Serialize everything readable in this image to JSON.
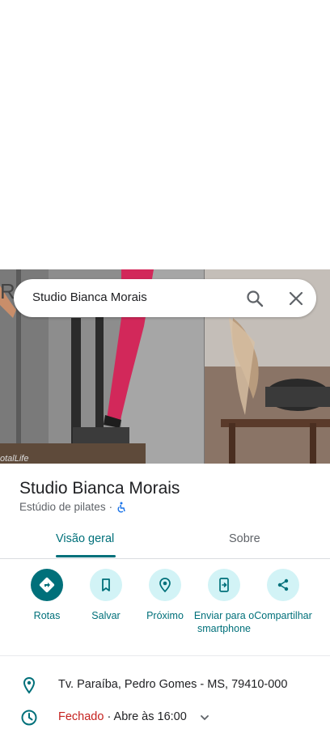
{
  "search": {
    "query": "Studio Bianca Morais"
  },
  "place": {
    "title": "Studio Bianca Morais",
    "category": "Estúdio de pilates",
    "separator": "·"
  },
  "photos": {
    "watermark_left": "R",
    "watermark_bottom": "otalLife"
  },
  "tabs": [
    {
      "label": "Visão geral",
      "active": true
    },
    {
      "label": "Sobre",
      "active": false
    }
  ],
  "actions": [
    {
      "label": "Rotas",
      "icon": "directions-icon"
    },
    {
      "label": "Salvar",
      "icon": "bookmark-icon"
    },
    {
      "label": "Próximo",
      "icon": "nearby-icon"
    },
    {
      "label": "Enviar para o smartphone",
      "icon": "send-to-phone-icon"
    },
    {
      "label": "Compartilhar",
      "icon": "share-icon"
    }
  ],
  "info": {
    "address": "Tv. Paraíba, Pedro Gomes - MS, 79410-000",
    "hours_status": "Fechado",
    "hours_detail": "· Abre às 16:00"
  },
  "colors": {
    "accent": "#00707a",
    "accent_light": "#d2f3f6",
    "closed": "#c5221f"
  }
}
